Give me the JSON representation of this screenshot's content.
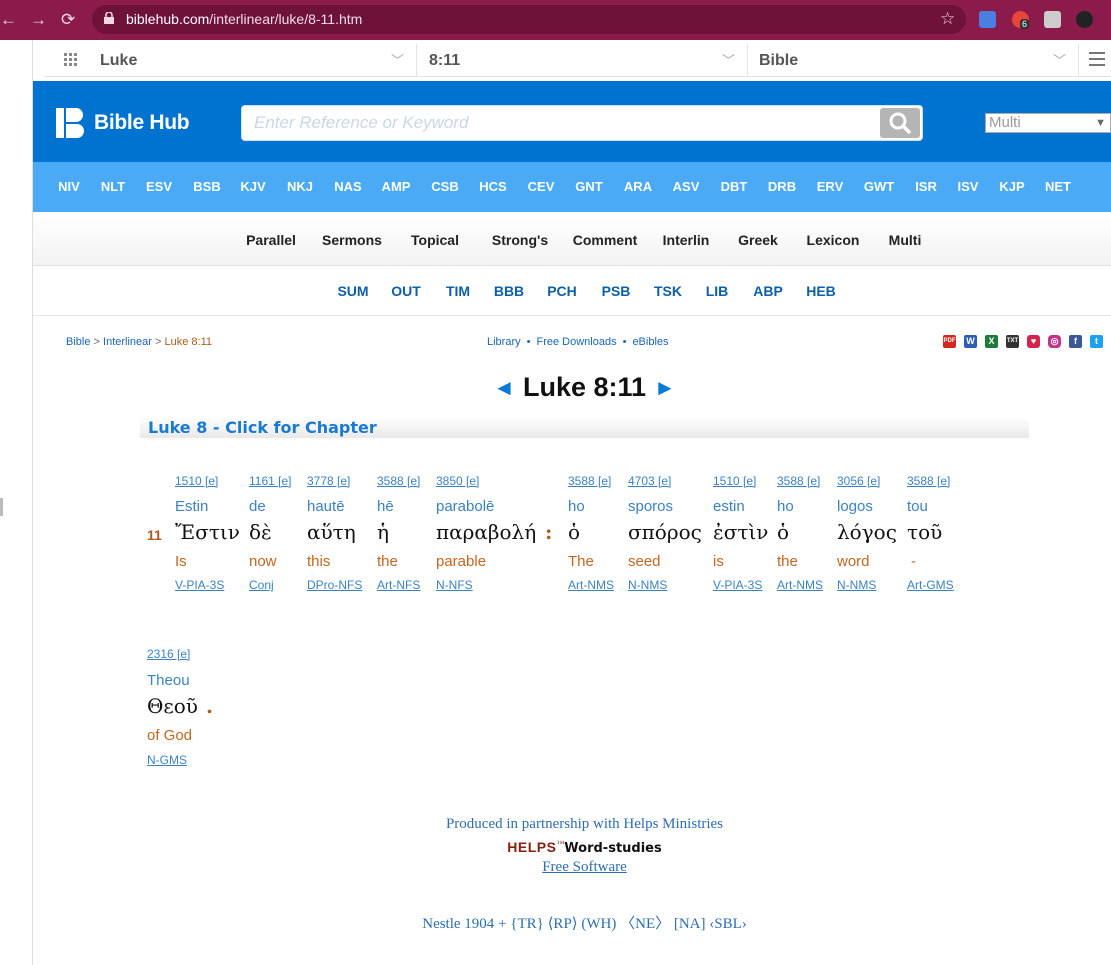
{
  "browser": {
    "url_host": "biblehub.com",
    "url_path": "/interlinear/luke/8-11.htm",
    "ext_badge": "6"
  },
  "selectors": {
    "book": "Luke",
    "chapter_verse": "8:11",
    "version": "Bible"
  },
  "header": {
    "logo_text": "Bible Hub",
    "search_placeholder": "Enter Reference or Keyword",
    "multi_select": "Multi"
  },
  "versions": [
    "NIV",
    "NLT",
    "ESV",
    "BSB",
    "KJV",
    "NKJ",
    "NAS",
    "AMP",
    "CSB",
    "HCS",
    "CEV",
    "GNT",
    "ARA",
    "ASV",
    "DBT",
    "DRB",
    "ERV",
    "GWT",
    "ISR",
    "ISV",
    "KJP",
    "NET"
  ],
  "tools": [
    "Parallel",
    "Sermons",
    "Topical",
    "Strong's",
    "Comment",
    "Interlin",
    "Greek",
    "Lexicon",
    "Multi"
  ],
  "commentaries": [
    "SUM",
    "OUT",
    "TIM",
    "BBB",
    "PCH",
    "PSB",
    "TSK",
    "LIB",
    "ABP",
    "HEB"
  ],
  "breadcrumb": {
    "bible": "Bible",
    "sep": ">",
    "interlinear": "Interlinear",
    "current": "Luke 8:11"
  },
  "library_links": {
    "library": "Library",
    "downloads": "Free Downloads",
    "ebibles": "eBibles",
    "dot": "•"
  },
  "share_icons": [
    "pdf-icon",
    "word-icon",
    "excel-icon",
    "txt-icon",
    "pocket-icon",
    "instagram-icon",
    "facebook-icon",
    "twitter-icon"
  ],
  "title": {
    "prev": "◄",
    "text": "Luke 8:11",
    "next": "►"
  },
  "chapter_link": "Luke 8 - Click for Chapter",
  "verse_number": "11",
  "words": [
    {
      "strong": "1510 [e]",
      "translit": "Estin",
      "greek": "Ἔστιν",
      "eng": "Is",
      "pos": "V-PIA-3S"
    },
    {
      "strong": "1161 [e]",
      "translit": "de",
      "greek": "δὲ",
      "eng": "now",
      "pos": "Conj"
    },
    {
      "strong": "3778 [e]",
      "translit": "hautē",
      "greek": "αὕτη",
      "eng": "this",
      "pos": "DPro-NFS"
    },
    {
      "strong": "3588 [e]",
      "translit": "hē",
      "greek": "ἡ",
      "eng": "the",
      "pos": "Art-NFS"
    },
    {
      "strong": "3850 [e]",
      "translit": "parabolē",
      "greek": "παραβολή",
      "eng": "parable",
      "pos": "N-NFS"
    },
    {
      "strong": "3588 [e]",
      "translit": "ho",
      "greek": "ὁ",
      "eng": "The",
      "pos": "Art-NMS"
    },
    {
      "strong": "4703 [e]",
      "translit": "sporos",
      "greek": "σπόρος",
      "eng": "seed",
      "pos": "N-NMS"
    },
    {
      "strong": "1510 [e]",
      "translit": "estin",
      "greek": "ἐστὶν",
      "eng": "is",
      "pos": "V-PIA-3S"
    },
    {
      "strong": "3588 [e]",
      "translit": "ho",
      "greek": "ὁ",
      "eng": "the",
      "pos": "Art-NMS"
    },
    {
      "strong": "3056 [e]",
      "translit": "logos",
      "greek": "λόγος",
      "eng": "word",
      "pos": "N-NMS"
    },
    {
      "strong": "3588 [e]",
      "translit": "tou",
      "greek": "τοῦ",
      "eng": "-",
      "pos": "Art-GMS"
    },
    {
      "strong": "2316 [e]",
      "translit": "Theou",
      "greek": "Θεοῦ",
      "eng": "of God",
      "pos": "N-GMS"
    }
  ],
  "punct": {
    "colon": ":",
    "period": "."
  },
  "footer": {
    "partnership": "Produced in partnership with Helps Ministries",
    "helps": "HELPS",
    "tm": "™",
    "word_studies": "Word-studies",
    "free_software": "Free Software",
    "editions": "Nestle 1904 + {TR} ⟨RP⟩ (WH) 〈NE〉 [NA] ‹SBL›"
  }
}
